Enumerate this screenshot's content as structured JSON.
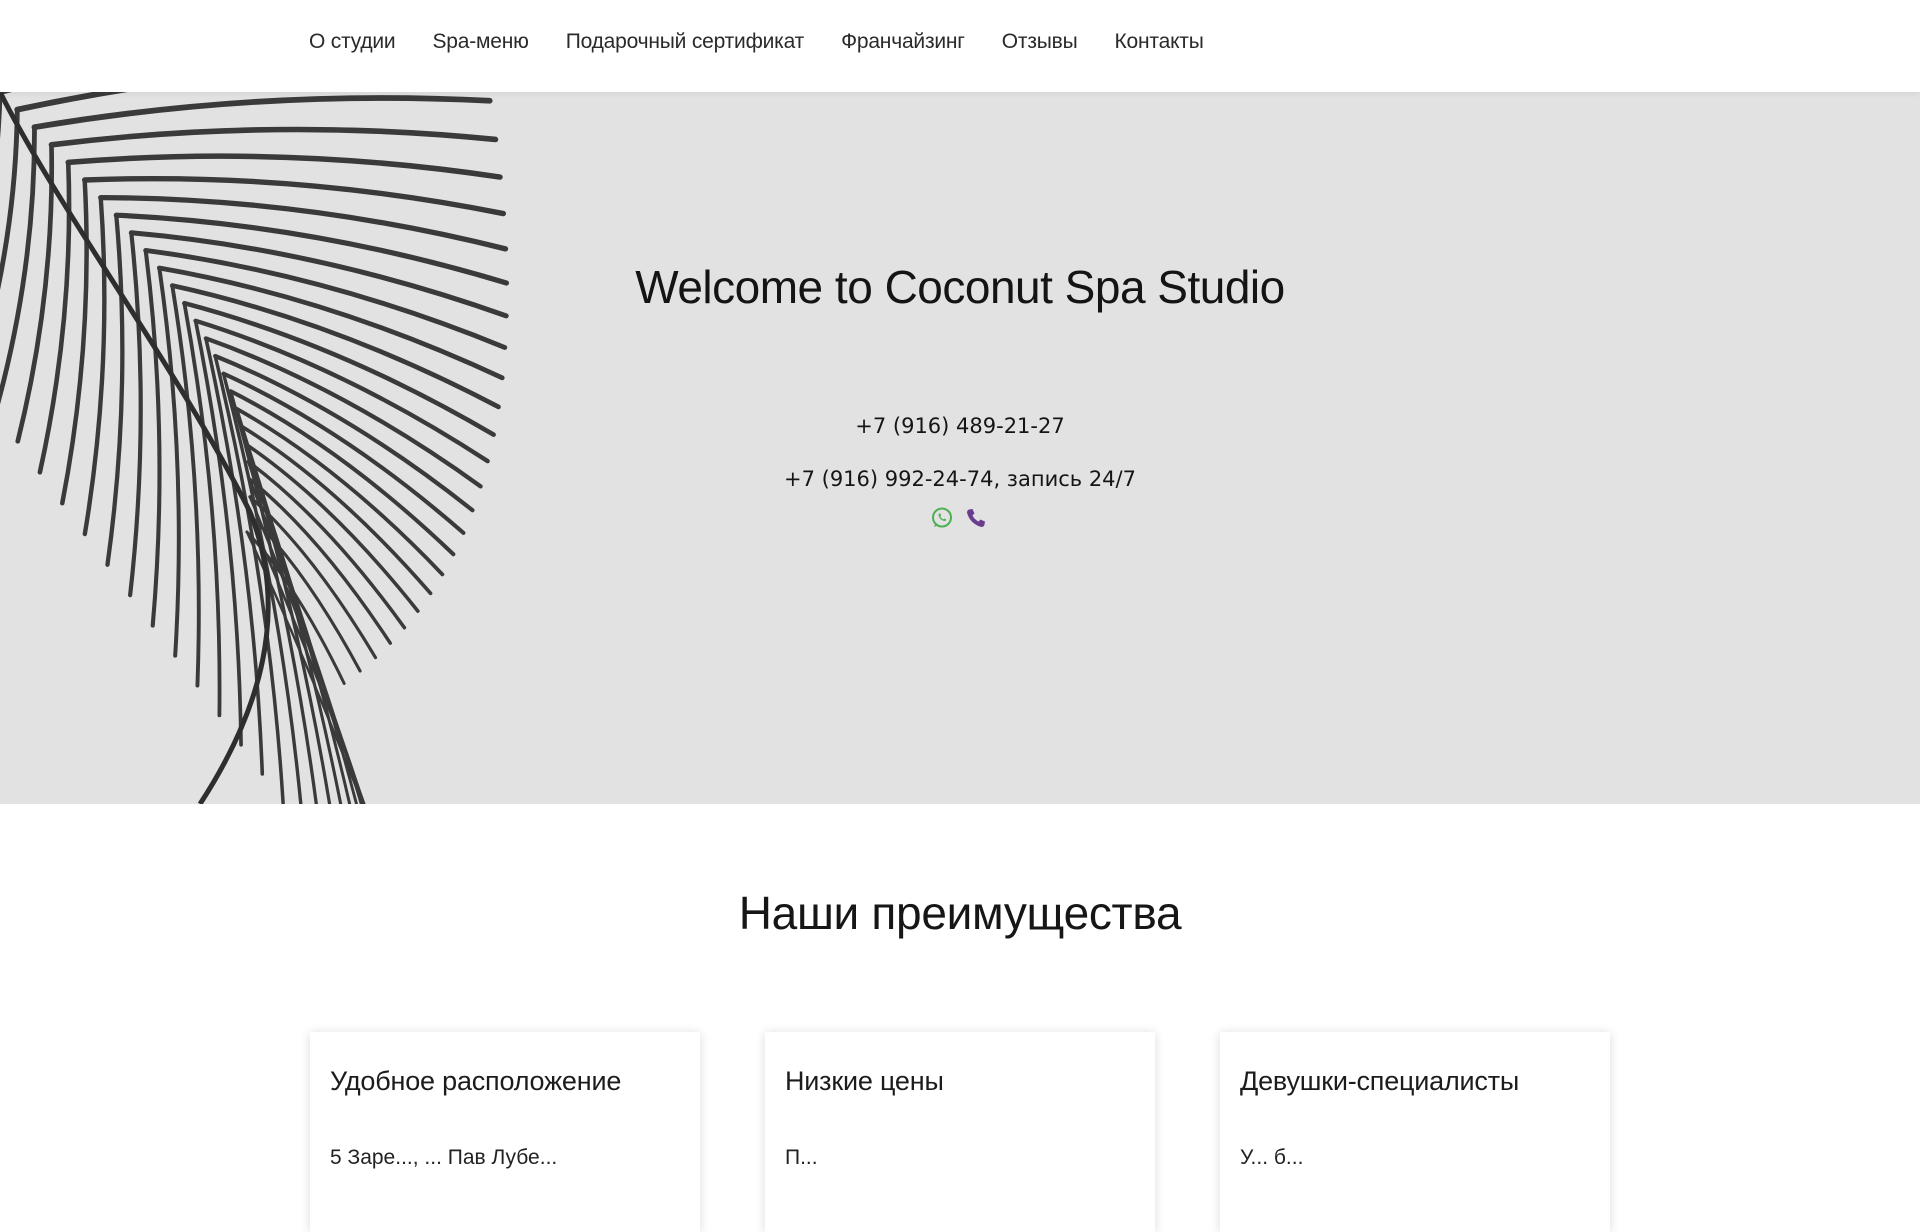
{
  "nav": {
    "items": [
      {
        "label": "О студии"
      },
      {
        "label": "Spa-меню"
      },
      {
        "label": "Подарочный сертификат"
      },
      {
        "label": "Франчайзинг"
      },
      {
        "label": "Отзывы"
      },
      {
        "label": "Контакты"
      }
    ]
  },
  "hero": {
    "title": "Welcome to Coconut Spa Studio",
    "phone_1": "+7 (916) 489-21-27",
    "phone_2": "+7 (916) 992-24-74, запись 24/7",
    "icons": [
      "whatsapp-icon",
      "viber-icon"
    ],
    "colors": {
      "background": "#e2e2e2",
      "whatsapp": "#4caf50",
      "viber": "#6a3d8f"
    }
  },
  "advantages": {
    "title": "Наши преимущества",
    "cards": [
      {
        "title": "Удобное расположение",
        "text": "5 Заре..., ... Пав Лубе..."
      },
      {
        "title": "Низкие цены",
        "text": "П..."
      },
      {
        "title": "Девушки-специалисты",
        "text": "У... б..."
      }
    ]
  }
}
